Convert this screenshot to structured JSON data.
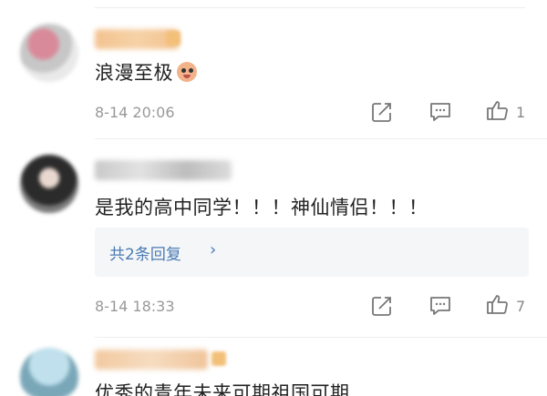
{
  "comments": [
    {
      "text": "浪漫至极",
      "emoji": "smiling-face-emoji",
      "timestamp": "8-14 20:06",
      "like_count": "1"
    },
    {
      "text": "是我的高中同学！！！神仙情侣！！！",
      "timestamp": "8-14 18:33",
      "like_count": "7",
      "replies_label": "共2条回复",
      "replies_chevron": "›"
    },
    {
      "text": "优秀的青年未来可期祖国可期"
    }
  ],
  "icons": {
    "share": "share-icon",
    "comment": "comment-icon",
    "like": "thumbs-up-icon"
  },
  "colors": {
    "link": "#4a7bb3",
    "timestamp": "#999999",
    "reply_box_bg": "#f5f6f8"
  }
}
